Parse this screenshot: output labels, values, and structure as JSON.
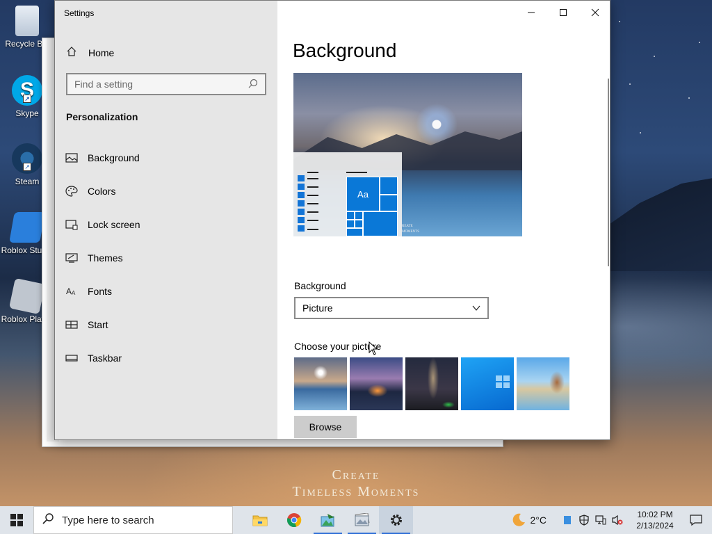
{
  "desktop": {
    "icons": [
      {
        "label": "Recycle Bin"
      },
      {
        "label": "Skype"
      },
      {
        "label": "Steam"
      },
      {
        "label": "Roblox Studio"
      },
      {
        "label": "Roblox Player"
      }
    ],
    "wallpaper_caption": {
      "line1": "Create",
      "line2": "Timeless Moments"
    }
  },
  "settings_window": {
    "title": "Settings",
    "sidebar": {
      "home_label": "Home",
      "search_placeholder": "Find a setting",
      "section_title": "Personalization",
      "items": [
        {
          "label": "Background",
          "icon": "picture-icon"
        },
        {
          "label": "Colors",
          "icon": "palette-icon"
        },
        {
          "label": "Lock screen",
          "icon": "lock-screen-icon"
        },
        {
          "label": "Themes",
          "icon": "themes-icon"
        },
        {
          "label": "Fonts",
          "icon": "fonts-icon"
        },
        {
          "label": "Start",
          "icon": "start-icon"
        },
        {
          "label": "Taskbar",
          "icon": "taskbar-icon"
        }
      ]
    },
    "main": {
      "heading": "Background",
      "preview": {
        "tile_text": "Aa",
        "caption_line1": "reate",
        "caption_line2": "moments"
      },
      "background_label": "Background",
      "background_value": "Picture",
      "choose_label": "Choose your picture",
      "browse_label": "Browse"
    }
  },
  "taskbar": {
    "search_placeholder": "Type here to search",
    "apps": [
      "file-explorer",
      "chrome",
      "image-editor",
      "photos",
      "settings"
    ],
    "weather": {
      "temp": "2°C"
    },
    "clock": {
      "time": "10:02 PM",
      "date": "2/13/2024"
    }
  },
  "colors": {
    "accent": "#0078d7",
    "sidebar_bg": "#e6e6e6",
    "taskbar_bg": "#dfe4ea"
  }
}
